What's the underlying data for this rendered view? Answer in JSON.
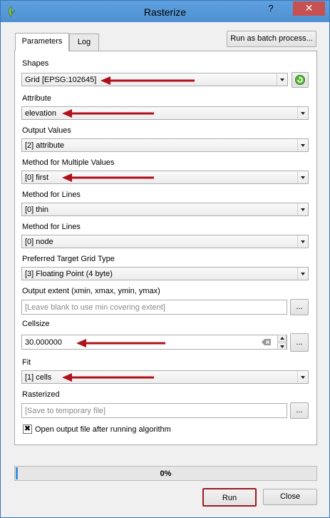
{
  "window": {
    "title": "Rasterize",
    "help_glyph": "?",
    "close_glyph": "✕"
  },
  "tabs": [
    {
      "label": "Parameters"
    },
    {
      "label": "Log"
    }
  ],
  "batch_button": "Run as batch process...",
  "fields": {
    "shapes": {
      "label": "Shapes",
      "value": "Grid [EPSG:102645]"
    },
    "attribute": {
      "label": "Attribute",
      "value": "elevation"
    },
    "output_values": {
      "label": "Output Values",
      "value": "[2] attribute"
    },
    "method_multiple": {
      "label": "Method for Multiple Values",
      "value": "[0] first"
    },
    "method_lines_1": {
      "label": "Method for Lines",
      "value": "[0] thin"
    },
    "method_lines_2": {
      "label": "Method for Lines",
      "value": "[0] node"
    },
    "grid_type": {
      "label": "Preferred Target Grid Type",
      "value": "[3] Floating Point (4 byte)"
    },
    "extent": {
      "label": "Output extent (xmin, xmax, ymin, ymax)",
      "placeholder": "[Leave blank to use min covering extent]"
    },
    "cellsize": {
      "label": "Cellsize",
      "value": "30.000000"
    },
    "fit": {
      "label": "Fit",
      "value": "[1] cells"
    },
    "rasterized": {
      "label": "Rasterized",
      "placeholder": "[Save to temporary file]"
    }
  },
  "browse_label": "...",
  "open_output": {
    "label": "Open output file after running algorithm",
    "checked": true,
    "mark": "✖"
  },
  "progress": {
    "value": 0,
    "text": "0%"
  },
  "buttons": {
    "run": "Run",
    "close": "Close"
  },
  "colors": {
    "annotation_arrow": "#b0101a",
    "title_bar": "#5a9bdc",
    "progress_fill": "#3d8ee0"
  }
}
